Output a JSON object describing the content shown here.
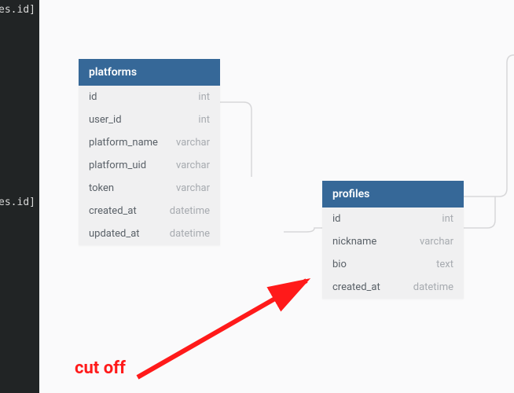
{
  "sidebar": {
    "lines": [
      "es.id]",
      "es.id]"
    ]
  },
  "entities": {
    "platforms": {
      "title": "platforms",
      "rows": [
        {
          "name": "id",
          "type": "int"
        },
        {
          "name": "user_id",
          "type": "int"
        },
        {
          "name": "platform_name",
          "type": "varchar"
        },
        {
          "name": "platform_uid",
          "type": "varchar"
        },
        {
          "name": "token",
          "type": "varchar"
        },
        {
          "name": "created_at",
          "type": "datetime"
        },
        {
          "name": "updated_at",
          "type": "datetime"
        }
      ]
    },
    "profiles": {
      "title": "profiles",
      "rows": [
        {
          "name": "id",
          "type": "int"
        },
        {
          "name": "nickname",
          "type": "varchar"
        },
        {
          "name": "bio",
          "type": "text"
        },
        {
          "name": "created_at",
          "type": "datetime"
        }
      ]
    }
  },
  "annotation": {
    "text": "cut off"
  }
}
